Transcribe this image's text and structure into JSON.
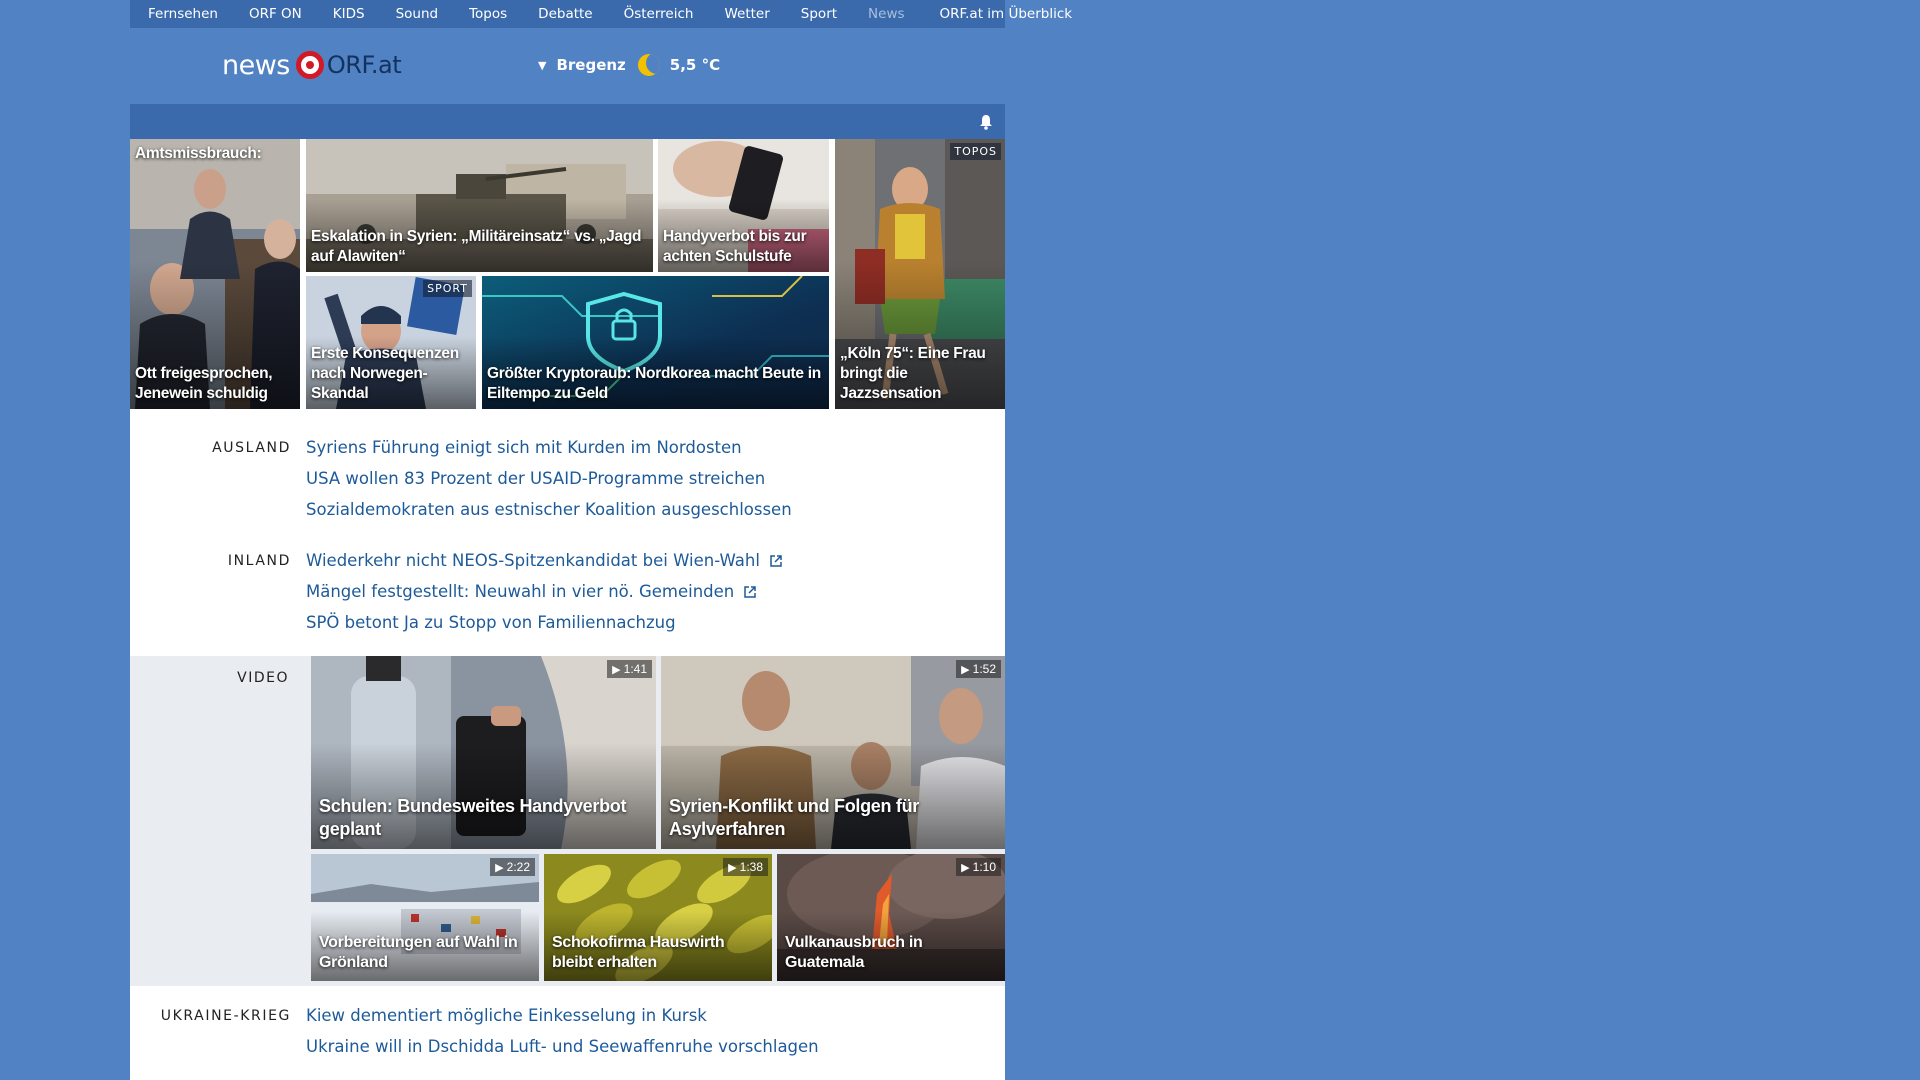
{
  "nav": {
    "items": [
      "Fernsehen",
      "ORF ON",
      "KIDS",
      "Sound",
      "Topos",
      "Debatte",
      "Österreich",
      "Wetter",
      "Sport",
      "News"
    ],
    "overview": "ORF.at im Überblick"
  },
  "logo": {
    "news": "news",
    "orf": "ORF.at"
  },
  "weather": {
    "location": "Bregenz",
    "temperature": "5,5 °C"
  },
  "tiles": [
    {
      "caption_top": "Amtsmissbrauch:",
      "caption": "Ott freigesprochen, Jenewein schuldig"
    },
    {
      "caption": "Eskalation in Syrien: „Militäreinsatz“ vs. „Jagd auf Alawiten“"
    },
    {
      "caption": "Handyverbot bis zur achten Schulstufe"
    },
    {
      "tag": "TOPOS",
      "caption": "„Köln 75“: Eine Frau bringt die Jazzsensation"
    },
    {
      "tag": "SPORT",
      "caption": "Erste Konsequenzen nach Norwegen-Skandal"
    },
    {
      "caption": "Größter Kryptoraub: Nordkorea macht Beute in Eiltempo zu Geld"
    }
  ],
  "sections": {
    "ausland": {
      "label": "AUSLAND",
      "items": [
        "Syriens Führung einigt sich mit Kurden im Nordosten",
        "USA wollen 83 Prozent der USAID-Programme streichen",
        "Sozialdemokraten aus estnischer Koalition ausgeschlossen"
      ]
    },
    "inland": {
      "label": "INLAND",
      "items": [
        "Wiederkehr nicht NEOS-Spitzenkandidat bei Wien-Wahl",
        "Mängel festgestellt: Neuwahl in vier nö. Gemeinden",
        "SPÖ betont Ja zu Stopp von Familiennachzug"
      ]
    },
    "ukraine": {
      "label": "UKRAINE-KRIEG",
      "items": [
        "Kiew dementiert mögliche Einkesselung in Kursk",
        "Ukraine will in Dschidda Luft- und Seewaffenruhe vorschlagen"
      ]
    }
  },
  "video": {
    "label": "VIDEO",
    "items": [
      {
        "duration": "1:41",
        "caption": "Schulen: Bundesweites Handyverbot geplant"
      },
      {
        "duration": "1:52",
        "caption": "Syrien-Konflikt und Folgen für Asylverfahren"
      },
      {
        "duration": "2:22",
        "caption": "Vorbereitungen auf Wahl in Grönland"
      },
      {
        "duration": "1:38",
        "caption": "Schokofirma Hauswirth bleibt erhalten"
      },
      {
        "duration": "1:10",
        "caption": "Vulkanausbruch in Guatemala"
      }
    ]
  }
}
